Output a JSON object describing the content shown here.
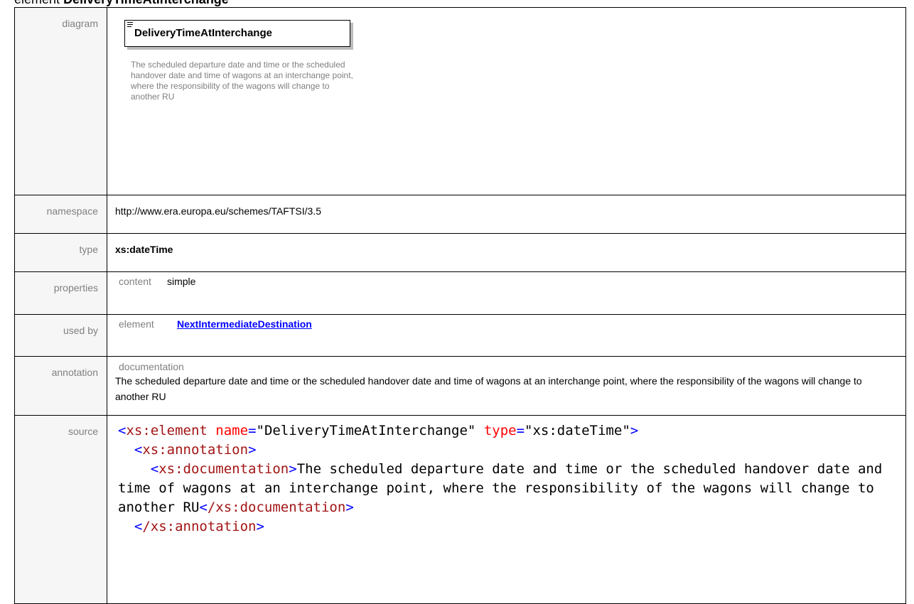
{
  "heading": {
    "prefix": "element",
    "name": "DeliveryTimeAtInterchange"
  },
  "rows": {
    "diagram": {
      "label": "diagram",
      "element_name": "DeliveryTimeAtInterchange",
      "documentation": "The scheduled departure date and time or the scheduled handover date and time of wagons at an interchange point, where the responsibility of the wagons will change to another RU"
    },
    "namespace": {
      "label": "namespace",
      "value": "http://www.era.europa.eu/schemes/TAFTSI/3.5"
    },
    "type": {
      "label": "type",
      "value": "xs:dateTime"
    },
    "properties": {
      "label": "properties",
      "key": "content",
      "value": "simple"
    },
    "used_by": {
      "label": "used by",
      "key": "element",
      "value": "NextIntermediateDestination"
    },
    "annotation": {
      "label": "annotation",
      "key": "documentation",
      "value": "The scheduled departure date and time or the scheduled handover date and time of wagons at an interchange point, where the responsibility of the wagons will change to another RU"
    },
    "source": {
      "label": "source",
      "open_tag": "xs:element",
      "attr_name": "name",
      "attr_name_value": "\"DeliveryTimeAtInterchange\"",
      "attr_type": "type",
      "attr_type_value": "\"xs:dateTime\"",
      "annotation_tag": "xs:annotation",
      "documentation_tag": "xs:documentation",
      "documentation_text": "The scheduled departure date and time or the scheduled handover date and time of wagons at an interchange point, where the responsibility of the wagons will change to another RU",
      "documentation_close": "/xs:documentation",
      "annotation_close": "/xs:annotation"
    }
  },
  "colors": {
    "tag": "#a31515",
    "bracket": "#0000ff",
    "attribute": "#ff0000",
    "link": "#0000ff",
    "label": "#808080"
  }
}
